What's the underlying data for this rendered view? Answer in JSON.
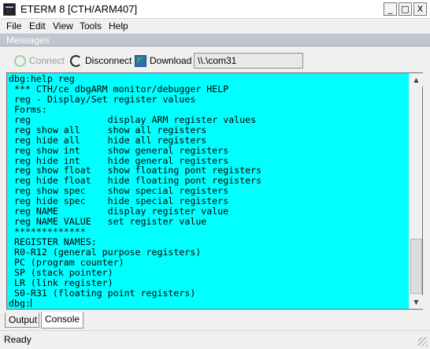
{
  "window": {
    "title": "ETERM 8 [CTH/ARM407]",
    "minimize": "_",
    "maximize": "□",
    "close": "X"
  },
  "menu": [
    "File",
    "Edit",
    "View",
    "Tools",
    "Help"
  ],
  "panel": {
    "title": "Messages",
    "restore": "⧉",
    "close": "×"
  },
  "toolbar": {
    "connect_label": "Connect",
    "disconnect_label": "Disconnect",
    "download_label": "Download",
    "port_value": "\\\\.\\com31"
  },
  "console": {
    "background": "#00ffff",
    "lines": [
      "dbg:help reg",
      " *** CTH/ce dbgARM monitor/debugger HELP",
      " reg - Display/Set register values",
      " Forms:",
      " reg              display ARM register values",
      " reg show all     show all registers",
      " reg hide all     hide all registers",
      " reg show int     show general registers",
      " reg hide int     hide general registers",
      " reg show float   show floating pont registers",
      " reg hide float   hide floating pont registers",
      " reg show spec    show special registers",
      " reg hide spec    hide special registers",
      " reg NAME         display register value",
      " reg NAME VALUE   set register value",
      " *************",
      " REGISTER NAMES:",
      " R0-R12 (general purpose registers)",
      " PC (program counter)",
      " SP (stack pointer)",
      " LR (link register)",
      " S0-R31 (floating point registers)"
    ],
    "prompt": "dbg:"
  },
  "tabs": [
    "Output",
    "Console"
  ],
  "status": "Ready"
}
